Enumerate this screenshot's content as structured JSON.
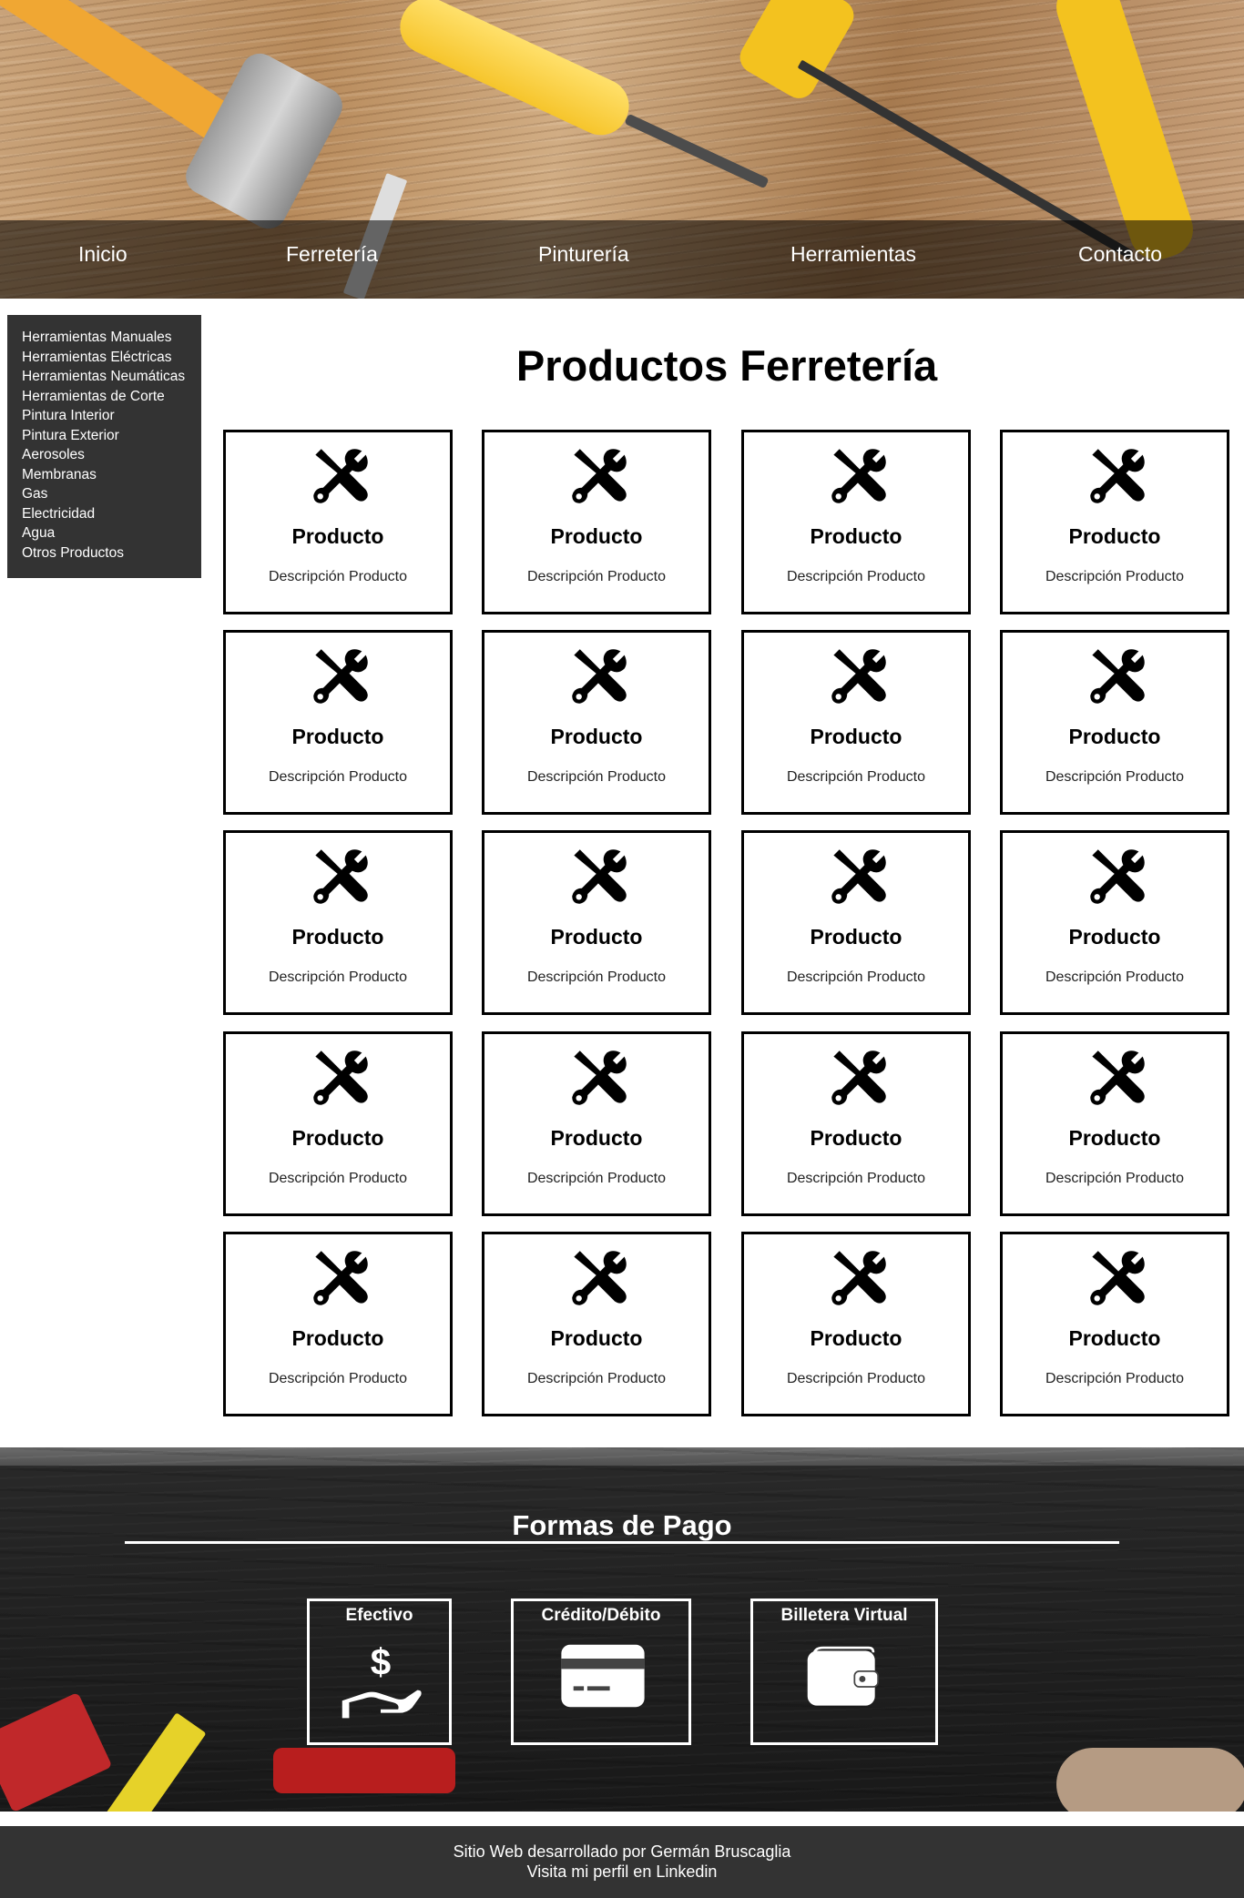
{
  "nav": {
    "items": [
      {
        "label": "Inicio"
      },
      {
        "label": "Ferretería"
      },
      {
        "label": "Pinturería"
      },
      {
        "label": "Herramientas"
      },
      {
        "label": "Contacto"
      }
    ]
  },
  "sidebar": {
    "items": [
      {
        "label": "Herramientas Manuales"
      },
      {
        "label": "Herramientas Eléctricas"
      },
      {
        "label": "Herramientas Neumáticas"
      },
      {
        "label": "Herramientas de Corte"
      },
      {
        "label": "Pintura Interior"
      },
      {
        "label": "Pintura Exterior"
      },
      {
        "label": "Aerosoles"
      },
      {
        "label": "Membranas"
      },
      {
        "label": "Gas"
      },
      {
        "label": "Electricidad"
      },
      {
        "label": "Agua"
      },
      {
        "label": "Otros Productos"
      }
    ]
  },
  "main": {
    "title": "Productos Ferretería",
    "products": [
      {
        "name": "Producto",
        "description": "Descripción Producto",
        "icon": "tools-icon"
      },
      {
        "name": "Producto",
        "description": "Descripción Producto",
        "icon": "tools-icon"
      },
      {
        "name": "Producto",
        "description": "Descripción Producto",
        "icon": "tools-icon"
      },
      {
        "name": "Producto",
        "description": "Descripción Producto",
        "icon": "tools-icon"
      },
      {
        "name": "Producto",
        "description": "Descripción Producto",
        "icon": "tools-icon"
      },
      {
        "name": "Producto",
        "description": "Descripción Producto",
        "icon": "tools-icon"
      },
      {
        "name": "Producto",
        "description": "Descripción Producto",
        "icon": "tools-icon"
      },
      {
        "name": "Producto",
        "description": "Descripción Producto",
        "icon": "tools-icon"
      },
      {
        "name": "Producto",
        "description": "Descripción Producto",
        "icon": "tools-icon"
      },
      {
        "name": "Producto",
        "description": "Descripción Producto",
        "icon": "tools-icon"
      },
      {
        "name": "Producto",
        "description": "Descripción Producto",
        "icon": "tools-icon"
      },
      {
        "name": "Producto",
        "description": "Descripción Producto",
        "icon": "tools-icon"
      },
      {
        "name": "Producto",
        "description": "Descripción Producto",
        "icon": "tools-icon"
      },
      {
        "name": "Producto",
        "description": "Descripción Producto",
        "icon": "tools-icon"
      },
      {
        "name": "Producto",
        "description": "Descripción Producto",
        "icon": "tools-icon"
      },
      {
        "name": "Producto",
        "description": "Descripción Producto",
        "icon": "tools-icon"
      },
      {
        "name": "Producto",
        "description": "Descripción Producto",
        "icon": "tools-icon"
      },
      {
        "name": "Producto",
        "description": "Descripción Producto",
        "icon": "tools-icon"
      },
      {
        "name": "Producto",
        "description": "Descripción Producto",
        "icon": "tools-icon"
      },
      {
        "name": "Producto",
        "description": "Descripción Producto",
        "icon": "tools-icon"
      }
    ]
  },
  "payment": {
    "title": "Formas de Pago",
    "methods": [
      {
        "label": "Efectivo",
        "icon": "cash-hand-icon"
      },
      {
        "label": "Crédito/Débito",
        "icon": "credit-card-icon"
      },
      {
        "label": "Billetera Virtual",
        "icon": "wallet-icon"
      }
    ]
  },
  "footer": {
    "line1": "Sitio Web desarrollado por Germán Bruscaglia",
    "line2": "Visita mi perfil en Linkedin"
  },
  "colors": {
    "nav_overlay": "#000000",
    "sidebar_bg": "#333333",
    "footer_bg": "#333333",
    "card_border": "#000000",
    "text_light": "#ffffff"
  }
}
